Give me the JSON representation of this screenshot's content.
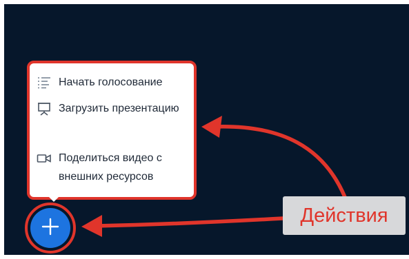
{
  "menu": {
    "items": [
      {
        "label": "Начать голосование",
        "icon": "poll-list-icon"
      },
      {
        "label": "Загрузить презентацию",
        "icon": "presentation-board-icon"
      },
      {
        "label": "Поделиться видео с внешних ресурсов",
        "icon": "video-camera-icon"
      }
    ]
  },
  "fab": {
    "icon": "plus-icon"
  },
  "callout": {
    "label": "Действия"
  },
  "colors": {
    "background": "#06172b",
    "accent_red": "#e0352b",
    "fab_blue": "#1d74e0",
    "callout_bg": "#d7d8da"
  }
}
